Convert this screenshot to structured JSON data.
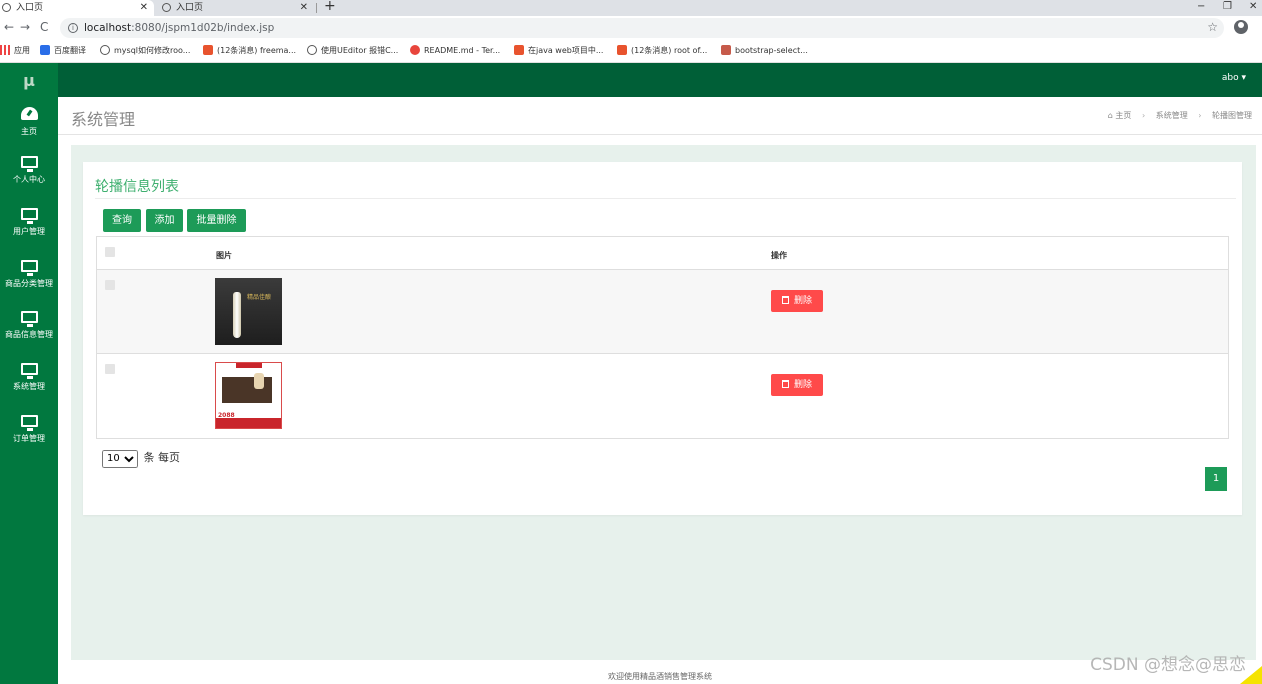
{
  "browser": {
    "tabs": [
      {
        "label": "入口页"
      },
      {
        "label": "入口页"
      }
    ],
    "close_glyph": "✕",
    "new_tab_glyph": "+",
    "window_controls": {
      "minimize": "−",
      "restore": "❐",
      "close": "✕"
    },
    "nav": {
      "back": "←",
      "forward": "→",
      "reload": "C"
    },
    "url": {
      "host": "localhost",
      "path": ":8080/jspm1d02b/index.jsp"
    },
    "star": "☆",
    "bookmarks": [
      {
        "label": "应用",
        "icon": "apps-icon"
      },
      {
        "label": "百度翻译",
        "icon": "translate-icon"
      },
      {
        "label": "mysql如何修改roo...",
        "icon": "github-icon"
      },
      {
        "label": "(12条消息) freema...",
        "icon": "csdn-icon"
      },
      {
        "label": "使用UEditor 报错C...",
        "icon": "github-icon"
      },
      {
        "label": "README.md - Ter...",
        "icon": "google-icon"
      },
      {
        "label": "在java web项目中...",
        "icon": "csdn-icon"
      },
      {
        "label": "(12条消息) root of...",
        "icon": "csdn-icon"
      },
      {
        "label": "bootstrap-select...",
        "icon": "bootstrap-icon"
      }
    ]
  },
  "app": {
    "logo": "μ",
    "sidebar": [
      {
        "label": "主页",
        "icon": "dashboard-icon"
      },
      {
        "label": "个人中心",
        "icon": "monitor-icon"
      },
      {
        "label": "用户管理",
        "icon": "monitor-icon"
      },
      {
        "label": "商品分类管理",
        "icon": "monitor-icon"
      },
      {
        "label": "商品信息管理",
        "icon": "monitor-icon"
      },
      {
        "label": "系统管理",
        "icon": "monitor-icon"
      },
      {
        "label": "订单管理",
        "icon": "monitor-icon"
      }
    ],
    "user": "abo ▾",
    "page_title": "系统管理",
    "breadcrumb": {
      "home": "主页",
      "home_icon": "home-icon",
      "level1": "系统管理",
      "level2": "轮播图管理",
      "separator": "›"
    },
    "panel_title": "轮播信息列表",
    "buttons": {
      "query": "查询",
      "add": "添加",
      "batch_delete": "批量删除"
    },
    "table": {
      "columns": [
        "",
        "图片",
        "操作"
      ],
      "rows": [
        {
          "image": "bottle-promo-image",
          "image_text": "精品佳酿",
          "action": "删除"
        },
        {
          "image": "giftbox-promo-image",
          "image_text": "2088",
          "action": "删除"
        }
      ]
    },
    "page_size": {
      "value": "10",
      "options": [
        "10"
      ],
      "suffix": "条 每页"
    },
    "pagination": {
      "current": "1"
    },
    "footer": "欢迎使用精品酒销售管理系统"
  },
  "watermark": "CSDN @想念@思恋",
  "colors": {
    "sidebar": "#01783f",
    "topbar": "#005f37",
    "accent": "#1d9b58",
    "danger": "#ff4a4a",
    "title": "#3eaf6f"
  }
}
